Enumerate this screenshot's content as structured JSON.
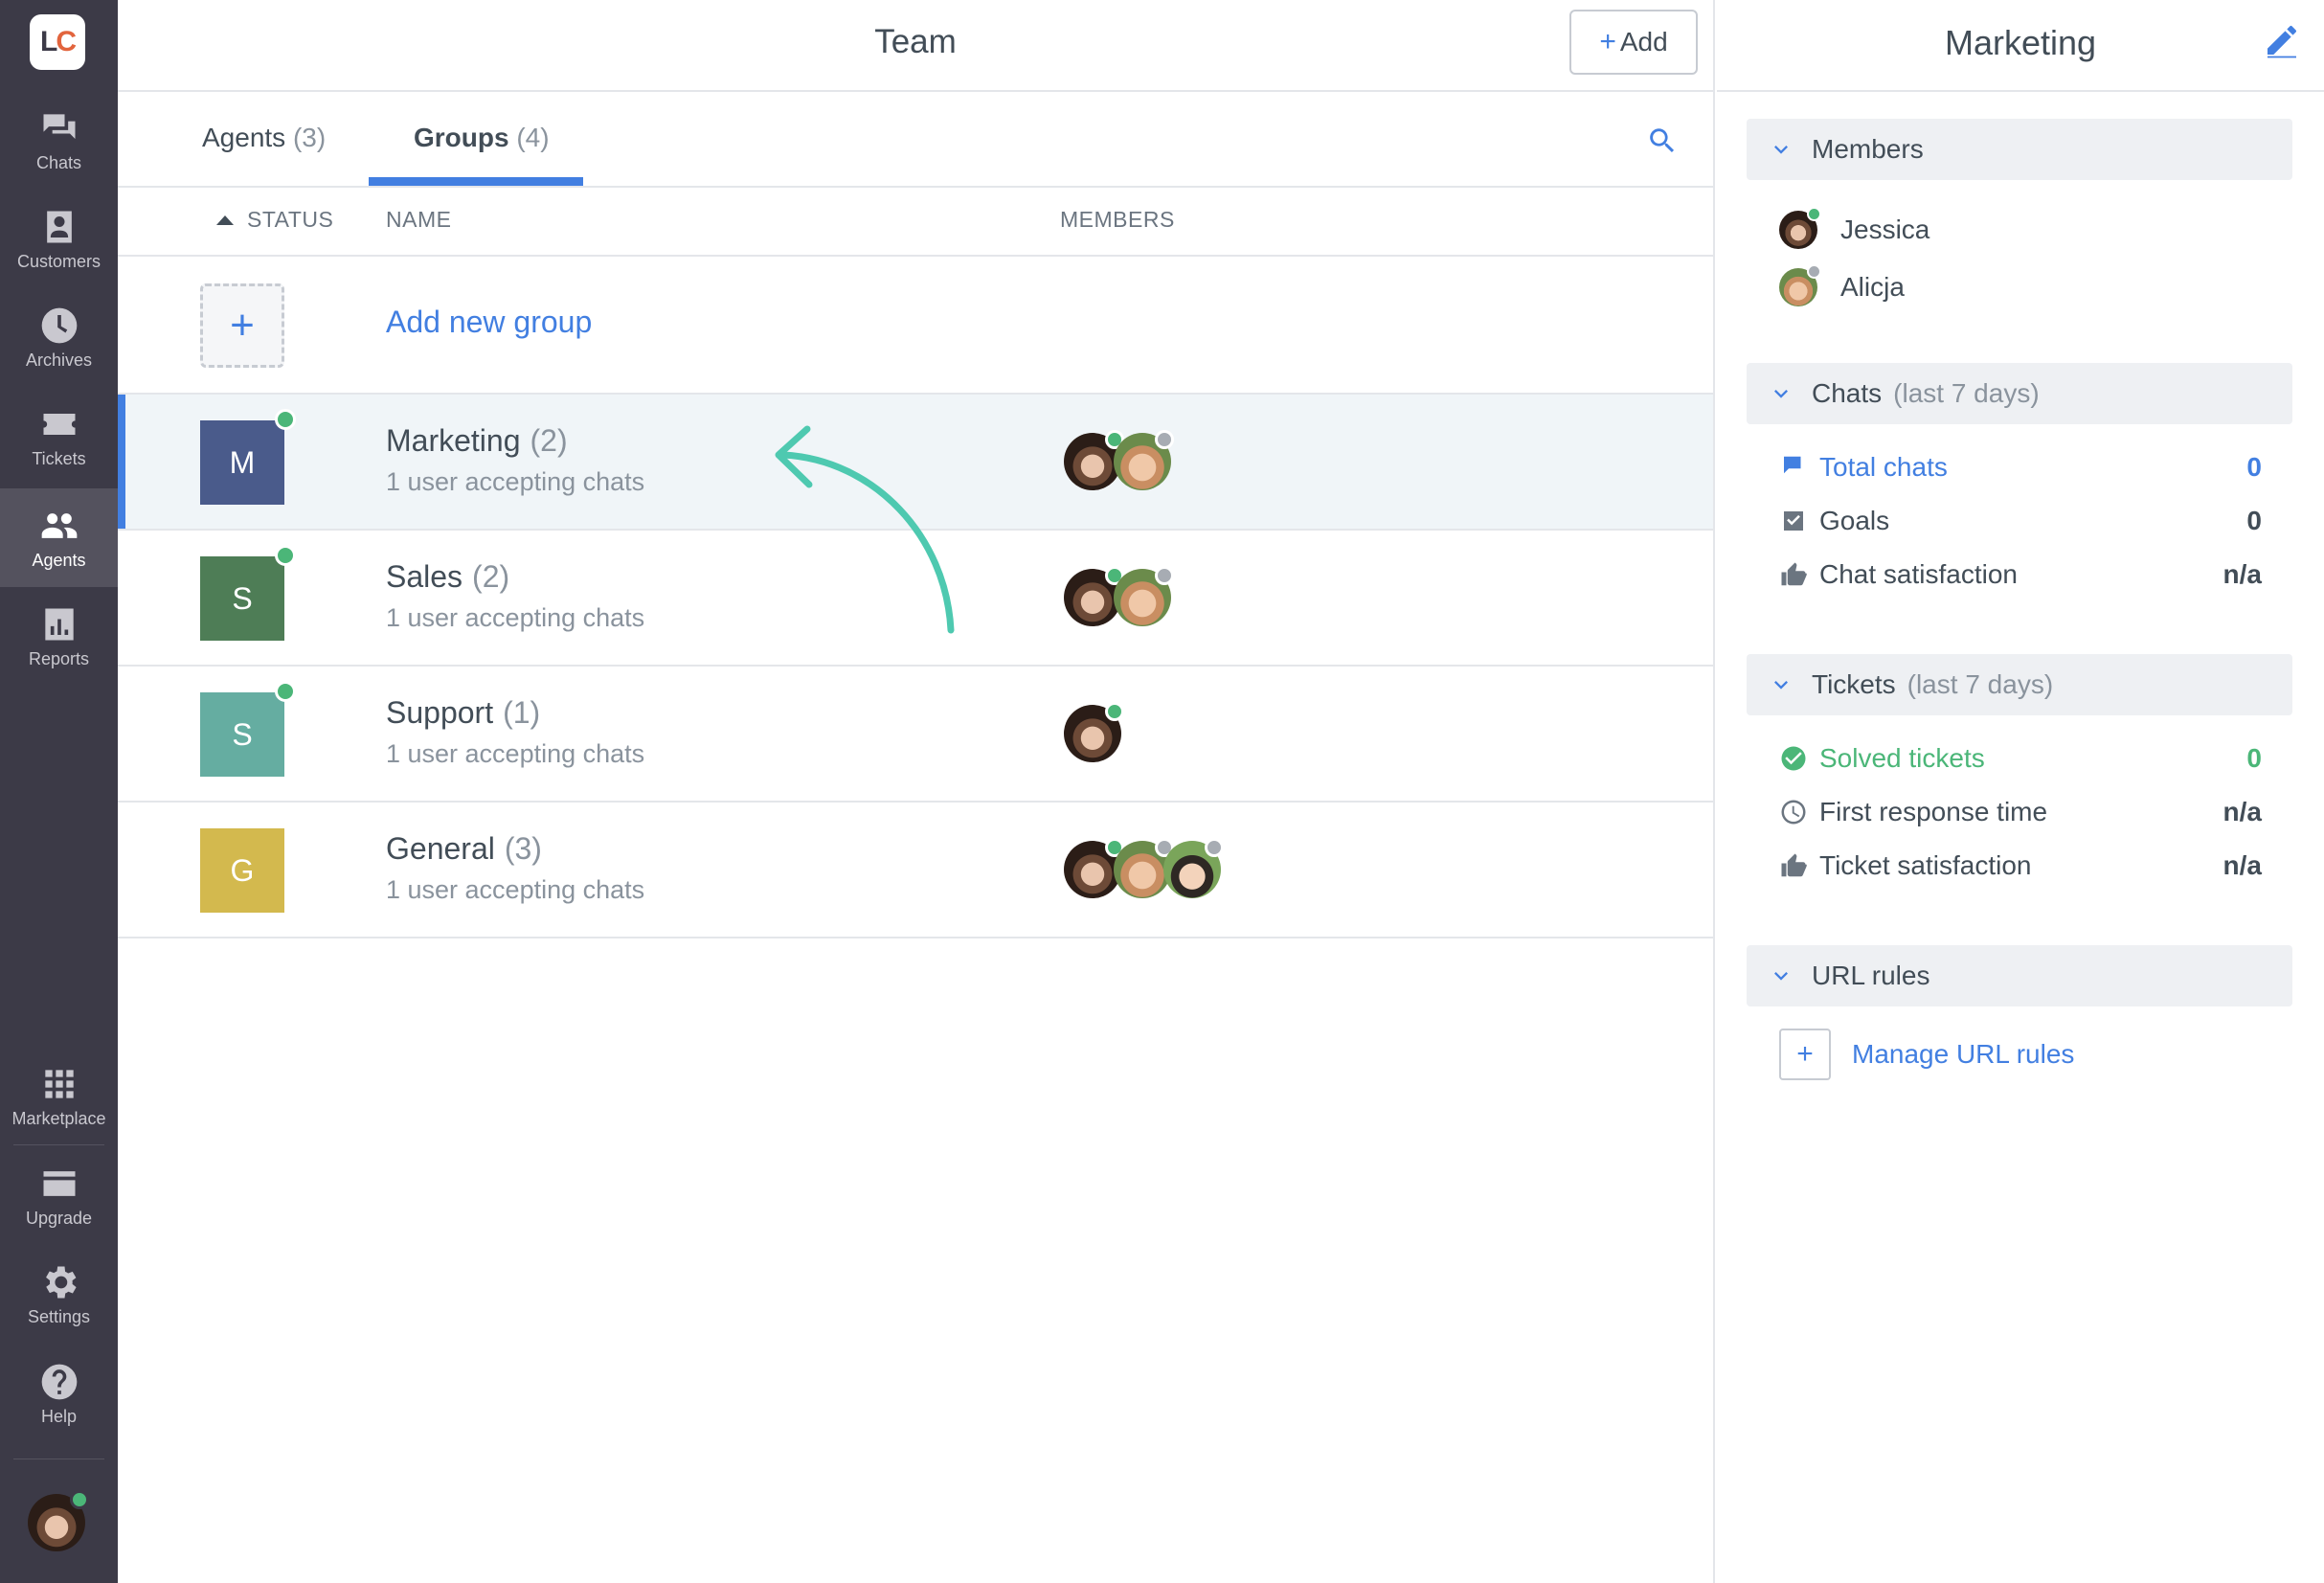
{
  "nav": {
    "logo": {
      "l": "L",
      "c": "C"
    },
    "items": [
      {
        "label": "Chats",
        "icon": "chat-icon"
      },
      {
        "label": "Customers",
        "icon": "customers-icon"
      },
      {
        "label": "Archives",
        "icon": "clock-icon"
      },
      {
        "label": "Tickets",
        "icon": "ticket-icon"
      },
      {
        "label": "Agents",
        "icon": "agents-icon",
        "active": true
      },
      {
        "label": "Reports",
        "icon": "reports-icon"
      }
    ],
    "bottom_items": [
      {
        "label": "Marketplace",
        "icon": "grid-icon"
      },
      {
        "label": "Upgrade",
        "icon": "card-icon"
      },
      {
        "label": "Settings",
        "icon": "gear-icon"
      },
      {
        "label": "Help",
        "icon": "help-icon"
      }
    ]
  },
  "header": {
    "title": "Team",
    "add_label": "Add",
    "add_plus": "+"
  },
  "tabs": [
    {
      "label": "Agents",
      "count": "(3)"
    },
    {
      "label": "Groups",
      "count": "(4)",
      "active": true
    }
  ],
  "table": {
    "headers": {
      "status": "STATUS",
      "name": "NAME",
      "members": "MEMBERS"
    },
    "add_row": {
      "plus": "+",
      "label": "Add new group"
    },
    "rows": [
      {
        "initial": "M",
        "name": "Marketing",
        "count": "(2)",
        "sub": "1 user accepting chats",
        "color": "#4a5b8b"
      },
      {
        "initial": "S",
        "name": "Sales",
        "count": "(2)",
        "sub": "1 user accepting chats",
        "color": "#4e7d56"
      },
      {
        "initial": "S",
        "name": "Support",
        "count": "(1)",
        "sub": "1 user accepting chats",
        "color": "#65ada1"
      },
      {
        "initial": "G",
        "name": "General",
        "count": "(3)",
        "sub": "1 user accepting chats",
        "color": "#d3b94e"
      }
    ]
  },
  "details": {
    "title": "Marketing",
    "members_section": "Members",
    "members": [
      {
        "name": "Jessica",
        "status": "online"
      },
      {
        "name": "Alicja",
        "status": "offline"
      }
    ],
    "chats_section": {
      "title": "Chats",
      "sub": "(last 7 days)"
    },
    "chats_stats": [
      {
        "label": "Total chats",
        "value": "0"
      },
      {
        "label": "Goals",
        "value": "0"
      },
      {
        "label": "Chat satisfaction",
        "value": "n/a"
      }
    ],
    "tickets_section": {
      "title": "Tickets",
      "sub": "(last 7 days)"
    },
    "tickets_stats": [
      {
        "label": "Solved tickets",
        "value": "0"
      },
      {
        "label": "First response time",
        "value": "n/a"
      },
      {
        "label": "Ticket satisfaction",
        "value": "n/a"
      }
    ],
    "url_section": "URL rules",
    "url_plus": "+",
    "url_link": "Manage URL rules"
  },
  "colors": {
    "accent": "#427fe1",
    "online": "#4bb678",
    "offline": "#a7acb3",
    "arrow": "#4ec9b0"
  }
}
